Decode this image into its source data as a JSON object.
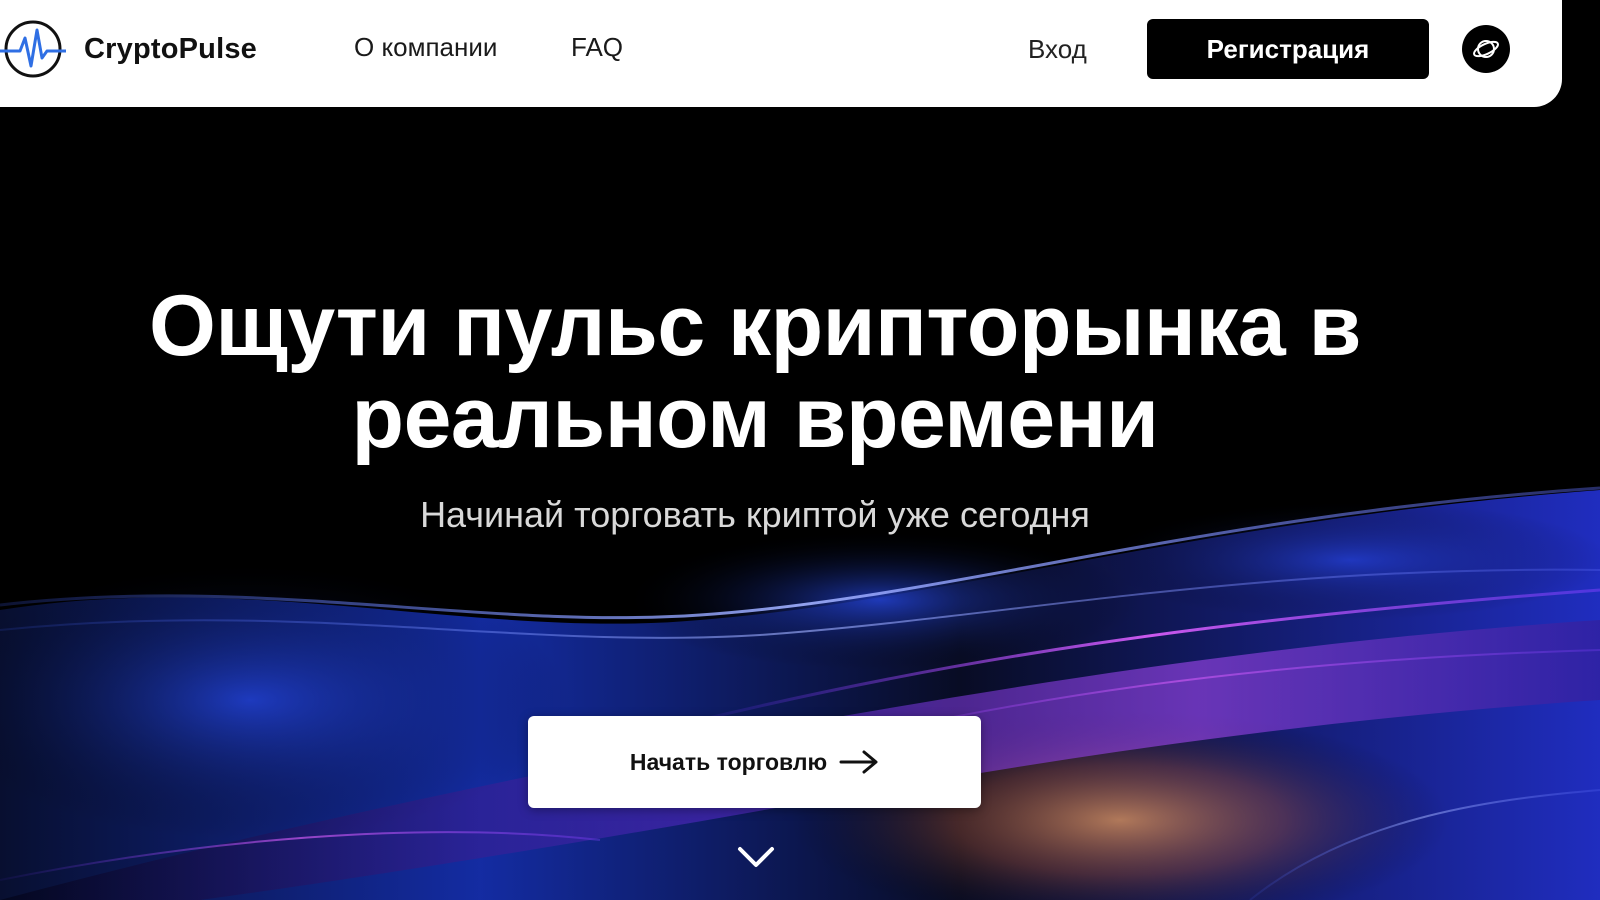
{
  "brand": {
    "name": "CryptoPulse",
    "icon": "pulse-logo-icon",
    "accent": "#2f6fe4"
  },
  "nav": {
    "items": [
      {
        "label": "О компании"
      },
      {
        "label": "FAQ"
      }
    ]
  },
  "auth": {
    "login_label": "Вход",
    "register_label": "Регистрация"
  },
  "language": {
    "icon": "planet-icon"
  },
  "hero": {
    "title": "Ощути пульс крипторынка в реальном времени",
    "subtitle": "Начинай торговать криптой уже сегодня",
    "cta_label": "Начать торговлю",
    "cta_icon": "arrow-right-icon",
    "scroll_icon": "chevron-down-icon"
  },
  "colors": {
    "header_bg": "#ffffff",
    "page_bg": "#000000",
    "wave_blue": "#1e3cff",
    "wave_purple": "#7a3cff",
    "wave_pink": "#d24cff",
    "wave_orange": "#e08a4a"
  }
}
